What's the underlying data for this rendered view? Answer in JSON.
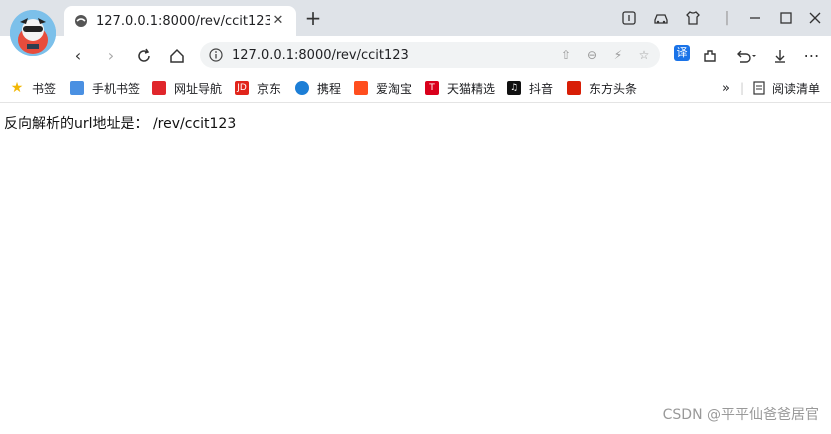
{
  "tab": {
    "title": "127.0.0.1:8000/rev/ccit123",
    "close": "✕"
  },
  "new_tab": "+",
  "address_bar": {
    "url": "127.0.0.1:8000/rev/ccit123"
  },
  "bookmarks": [
    {
      "label": "书签",
      "icon": "star-icon",
      "color": "#f2b705"
    },
    {
      "label": "手机书签",
      "icon": "phone-icon",
      "color": "#4a90e2"
    },
    {
      "label": "网址导航",
      "icon": "nav-icon",
      "color": "#e0262b"
    },
    {
      "label": "京东",
      "icon": "jd-icon",
      "color": "#e1251b"
    },
    {
      "label": "携程",
      "icon": "ctrip-icon",
      "color": "#1c7ed6"
    },
    {
      "label": "爱淘宝",
      "icon": "taobao-icon",
      "color": "#ff4e1e"
    },
    {
      "label": "天猫精选",
      "icon": "tmall-icon",
      "color": "#d9001b"
    },
    {
      "label": "抖音",
      "icon": "douyin-icon",
      "color": "#111111"
    },
    {
      "label": "东方头条",
      "icon": "toutiao-icon",
      "color": "#d81e06"
    }
  ],
  "reading_list": "阅读清单",
  "content": {
    "text": "反向解析的url地址是： /rev/ccit123"
  },
  "watermark": "CSDN @平平仙爸爸居官"
}
